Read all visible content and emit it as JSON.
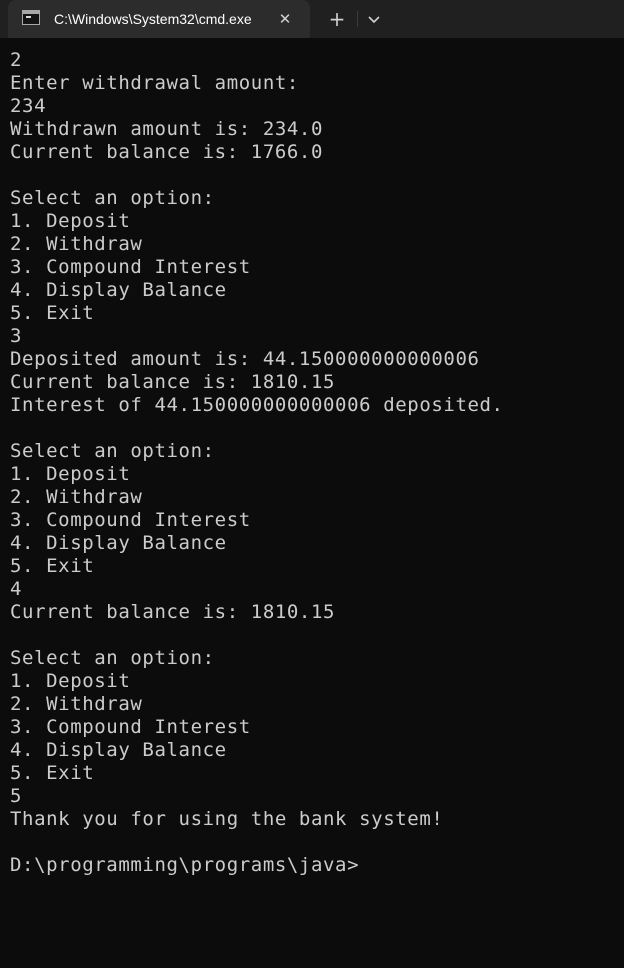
{
  "window": {
    "tab_title": "C:\\Windows\\System32\\cmd.exe",
    "close_glyph": "✕",
    "new_tab_glyph": "+",
    "icon": "cmd-prompt-icon",
    "colors": {
      "background": "#0c0c0c",
      "titlebar": "#202020",
      "active_tab": "#2c2c2c",
      "text": "#cccccc"
    }
  },
  "console": {
    "lines": [
      "2",
      "Enter withdrawal amount:",
      "234",
      "Withdrawn amount is: 234.0",
      "Current balance is: 1766.0",
      "",
      "Select an option:",
      "1. Deposit",
      "2. Withdraw",
      "3. Compound Interest",
      "4. Display Balance",
      "5. Exit",
      "3",
      "Deposited amount is: 44.150000000000006",
      "Current balance is: 1810.15",
      "Interest of 44.150000000000006 deposited.",
      "",
      "Select an option:",
      "1. Deposit",
      "2. Withdraw",
      "3. Compound Interest",
      "4. Display Balance",
      "5. Exit",
      "4",
      "Current balance is: 1810.15",
      "",
      "Select an option:",
      "1. Deposit",
      "2. Withdraw",
      "3. Compound Interest",
      "4. Display Balance",
      "5. Exit",
      "5",
      "Thank you for using the bank system!",
      "",
      "D:\\programming\\programs\\java>"
    ]
  }
}
